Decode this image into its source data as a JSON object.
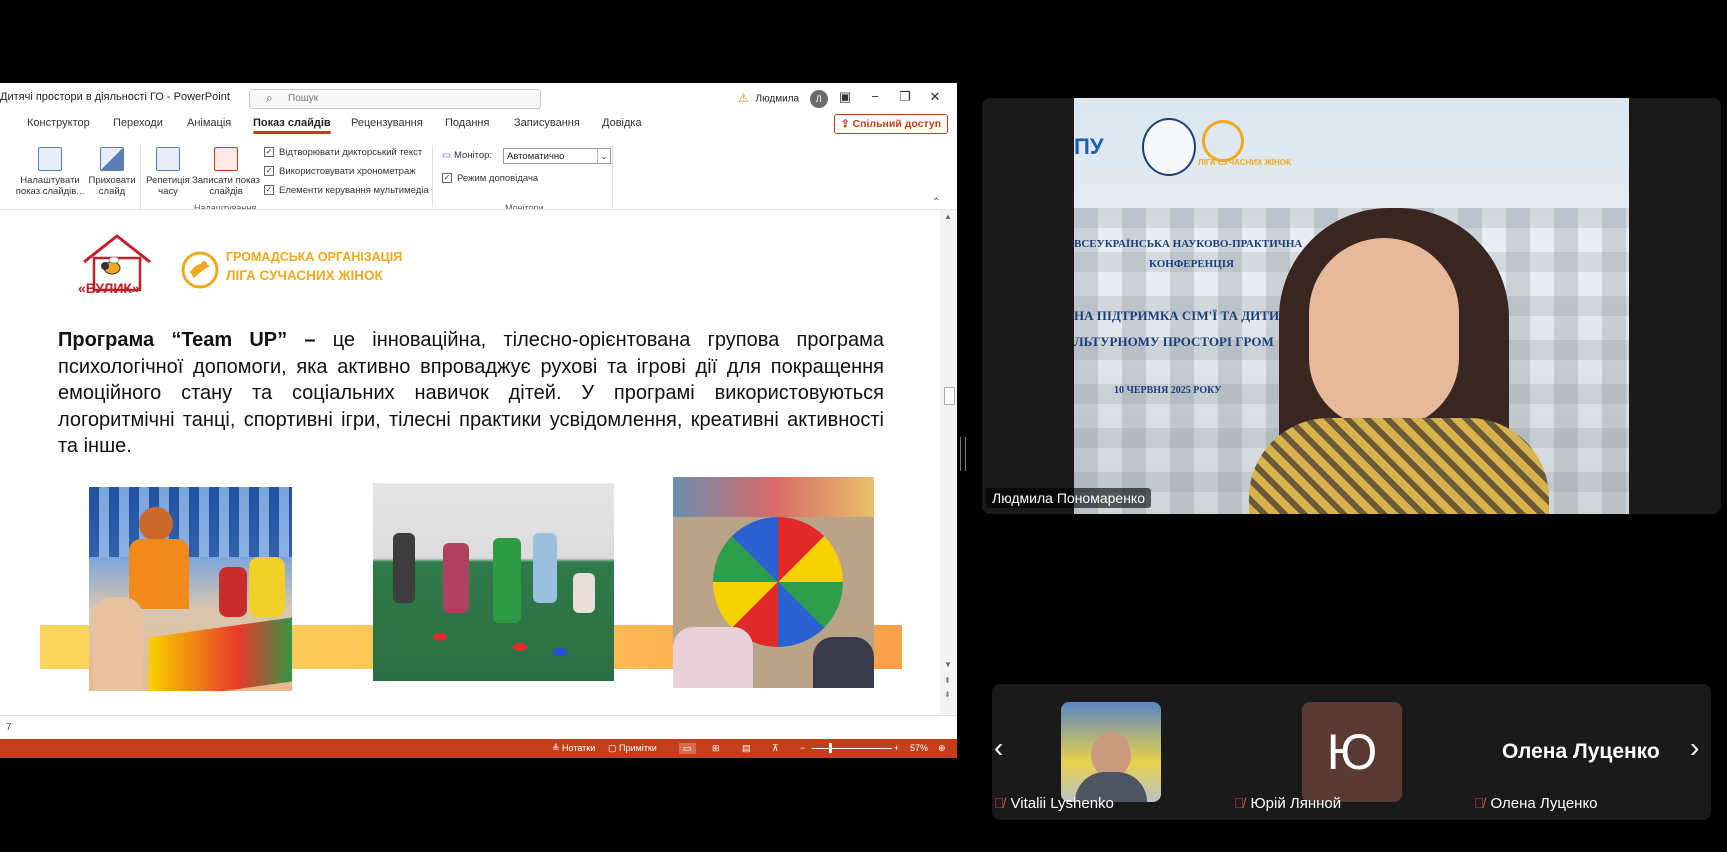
{
  "window": {
    "title": "Дитячі простори в діяльності ГО  -  PowerPoint",
    "search_placeholder": "Пошук",
    "user_name": "Людмила",
    "user_initial": "Л"
  },
  "tabs": [
    "Конструктор",
    "Переходи",
    "Анімація",
    "Показ слайдів",
    "Рецензування",
    "Подання",
    "Записування",
    "Довідка"
  ],
  "active_tab": "Показ слайдів",
  "share_label": "Спільний доступ",
  "ribbon": {
    "btn_setup": "Налаштувати показ слайдів...",
    "btn_hide": "Приховати слайд",
    "btn_rehearse": "Репетиція часу",
    "btn_record": "Записати показ слайдів",
    "chk_narration": "Відтворювати дикторський текст",
    "chk_timings": "Використовувати хронометраж",
    "chk_media": "Елементи керування мультимедіа",
    "group_setup": "Налаштування",
    "monitor_label": "Монітор:",
    "monitor_value": "Автоматично",
    "presenter_view": "Режим доповідача",
    "group_monitors": "Монітори"
  },
  "slide": {
    "vulik_text": "«ВУЛИК»",
    "liga_line1": "ГРОМАДСЬКА ОРГАНІЗАЦІЯ",
    "liga_line2": "ЛІГА СУЧАСНИХ ЖІНОК",
    "body_bold": "Програма “Team UP” –",
    "body_rest": " це інноваційна, тілесно-орієнтована групова програма психологічної допомоги, яка активно впроваджує рухові та ігрові дії для покращення емоційного стану та соціальних навичок дітей. У програмі використовуються логоритмічні танці, спортивні ігри, тілесні практики усвідомлення, креативні активності та інше."
  },
  "slide_number": "7",
  "statusbar": {
    "notes": "Нотатки",
    "comments": "Примітки",
    "zoom": "57%"
  },
  "video": {
    "speaker_name": "Людмила Пономаренко",
    "background_lines": [
      "ВСЕУКРАЇНСЬКА НАУКОВО-ПРАКТИЧНА",
      "КОНФЕРЕНЦІЯ",
      "НА ПІДТРИМКА СІМ'Ї ТА ДИТИН",
      "ЛЬТУРНОМУ ПРОСТОРІ ГРОМ",
      "10 ЧЕРВНЯ 2025 РОКУ"
    ],
    "logo_text": "ЛІГА СУЧАСНИХ ЖІНОК",
    "partial_logo": "ПУ"
  },
  "participants": [
    {
      "name": "Vitalii Lyshenko",
      "muted": true
    },
    {
      "name": "Юрій Лянной",
      "initial": "Ю",
      "muted": true
    },
    {
      "name": "Олена Луценко",
      "muted": true
    }
  ],
  "colors": {
    "ppt_accent": "#c43e1c",
    "liga_orange": "#f2a81d",
    "vulik_red": "#c0202a"
  }
}
